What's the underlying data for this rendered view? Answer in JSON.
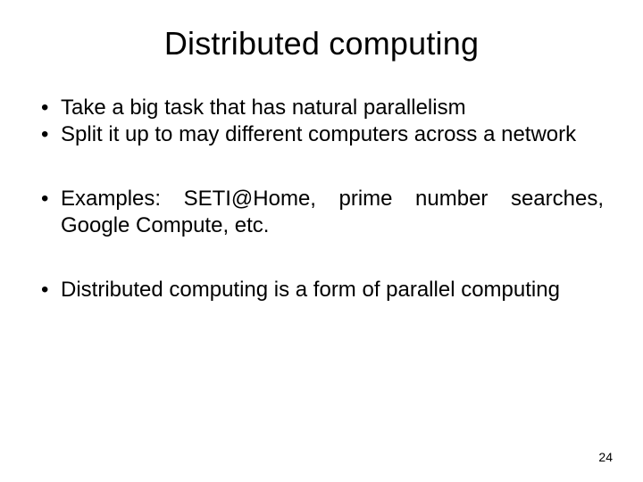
{
  "title": "Distributed computing",
  "bullets": [
    "Take a big task that has natural parallelism",
    "Split it up to may different computers across a network",
    "Examples: SETI@Home, prime number searches, Google Compute, etc.",
    "Distributed computing is a form of parallel computing"
  ],
  "page_number": "24"
}
